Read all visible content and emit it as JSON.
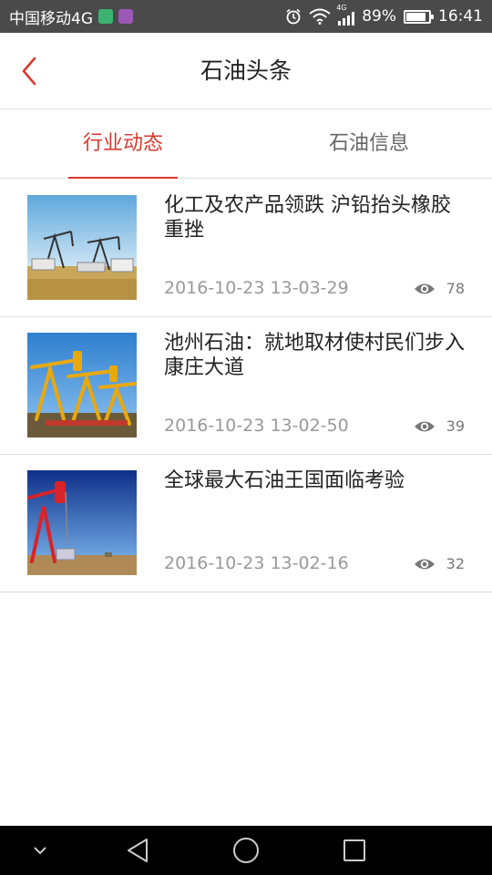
{
  "status_bar": {
    "carrier": "中国移动4G",
    "network_badge": "4G",
    "battery_percent": "89%",
    "battery_level": 0.89,
    "time": "16:41"
  },
  "header": {
    "title": "石油头条",
    "back_icon": "chevron-left-icon",
    "accent_color": "#d93a2f"
  },
  "tabs": [
    {
      "label": "行业动态",
      "active": true
    },
    {
      "label": "石油信息",
      "active": false
    }
  ],
  "articles": [
    {
      "title": "化工及农产品领跌 沪铅抬头橡胶重挫",
      "date": "2016-10-23 13-03-29",
      "views": "78",
      "thumb": "oilfield-pumps-grass"
    },
    {
      "title": "池州石油：就地取材使村民们步入康庄大道",
      "date": "2016-10-23 13-02-50",
      "views": "39",
      "thumb": "yellow-pumpjacks"
    },
    {
      "title": "全球最大石油王国面临考验",
      "date": "2016-10-23 13-02-16",
      "views": "32",
      "thumb": "red-pumpjack-desert"
    }
  ],
  "nav": {
    "icons": [
      "chevron-down-icon",
      "back-triangle-icon",
      "home-circle-icon",
      "recents-square-icon"
    ]
  }
}
